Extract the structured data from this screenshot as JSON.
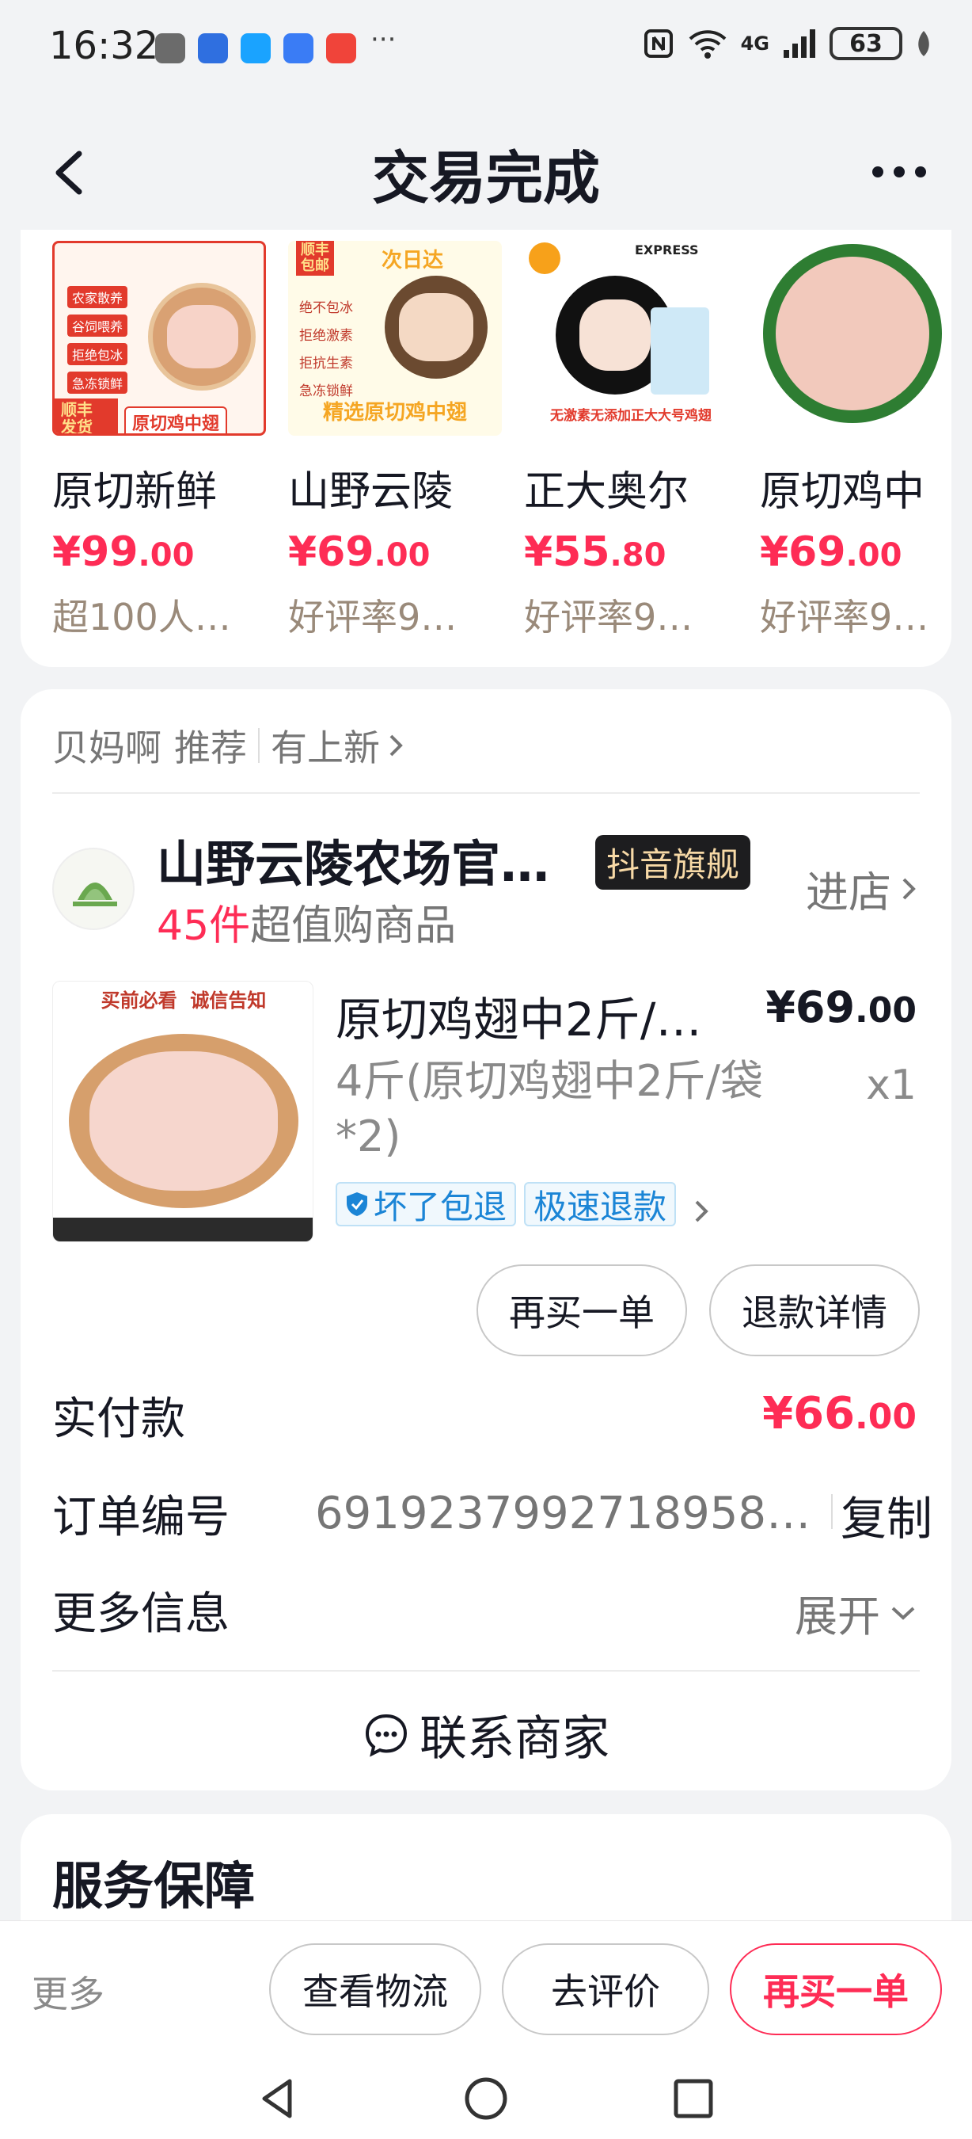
{
  "status_bar": {
    "time": "16:32",
    "more": "···",
    "network": "4G",
    "battery": "63"
  },
  "nav": {
    "title": "交易完成"
  },
  "recommendations": [
    {
      "name": "原切新鲜",
      "price_int": "¥99",
      "price_dec": ".00",
      "sub": "超100人…"
    },
    {
      "name": "山野云陵",
      "price_int": "¥69",
      "price_dec": ".00",
      "sub": "好评率9…"
    },
    {
      "name": "正大奥尔",
      "price_int": "¥55",
      "price_dec": ".80",
      "sub": "好评率9…"
    },
    {
      "name": "原切鸡中",
      "price_int": "¥69",
      "price_dec": ".00",
      "sub": "好评率9…"
    }
  ],
  "reco_images": {
    "img1_badge": "顺丰\n发货",
    "img1_caption": "原切鸡中翅",
    "img1_list": [
      "农家散养",
      "谷饲喂养",
      "拒绝包冰",
      "急冻锁鲜"
    ],
    "img2_head": "次日达",
    "img2_badge": "顺丰\n包邮",
    "img2_list": [
      "绝不包冰",
      "拒绝激素",
      "拒抗生素",
      "急冻锁鲜"
    ],
    "img2_caption": "精选原切鸡中翅",
    "img3_caption": "无激素无添加正大大号鸡翅",
    "img3_express": "EXPRESS"
  },
  "order": {
    "source_from": "贝妈啊",
    "source_recommend": "推荐",
    "source_new": "有上新",
    "shop_name": "山野云陵农场官…",
    "shop_badge": "抖音旗舰",
    "shop_count": "45件",
    "shop_sub": "超值购商品",
    "enter_shop": "进店",
    "product_title": "原切鸡翅中2斤/…",
    "product_price_int": "¥69",
    "product_price_dec": ".00",
    "product_spec": "4斤(原切鸡翅中2斤/袋*2)",
    "product_qty": "x1",
    "product_img_head": "买前必看  诚信告知",
    "tags": [
      "坏了包退",
      "极速退款"
    ],
    "btn_rebuy": "再买一单",
    "btn_refund": "退款详情",
    "paid_label": "实付款",
    "paid_int": "¥66",
    "paid_dec": ".00",
    "order_no_label": "订单编号",
    "order_no": "6919237992718958…",
    "copy": "复制",
    "more_info_label": "更多信息",
    "expand": "展开",
    "contact": "联系商家"
  },
  "service": {
    "title": "服务保障"
  },
  "bottom_bar": {
    "more": "更多",
    "logistics": "查看物流",
    "review": "去评价",
    "rebuy": "再买一单"
  },
  "colors": {
    "accent": "#fe2c55",
    "background": "#f2f3f5",
    "tag_blue": "#1b85d6"
  }
}
